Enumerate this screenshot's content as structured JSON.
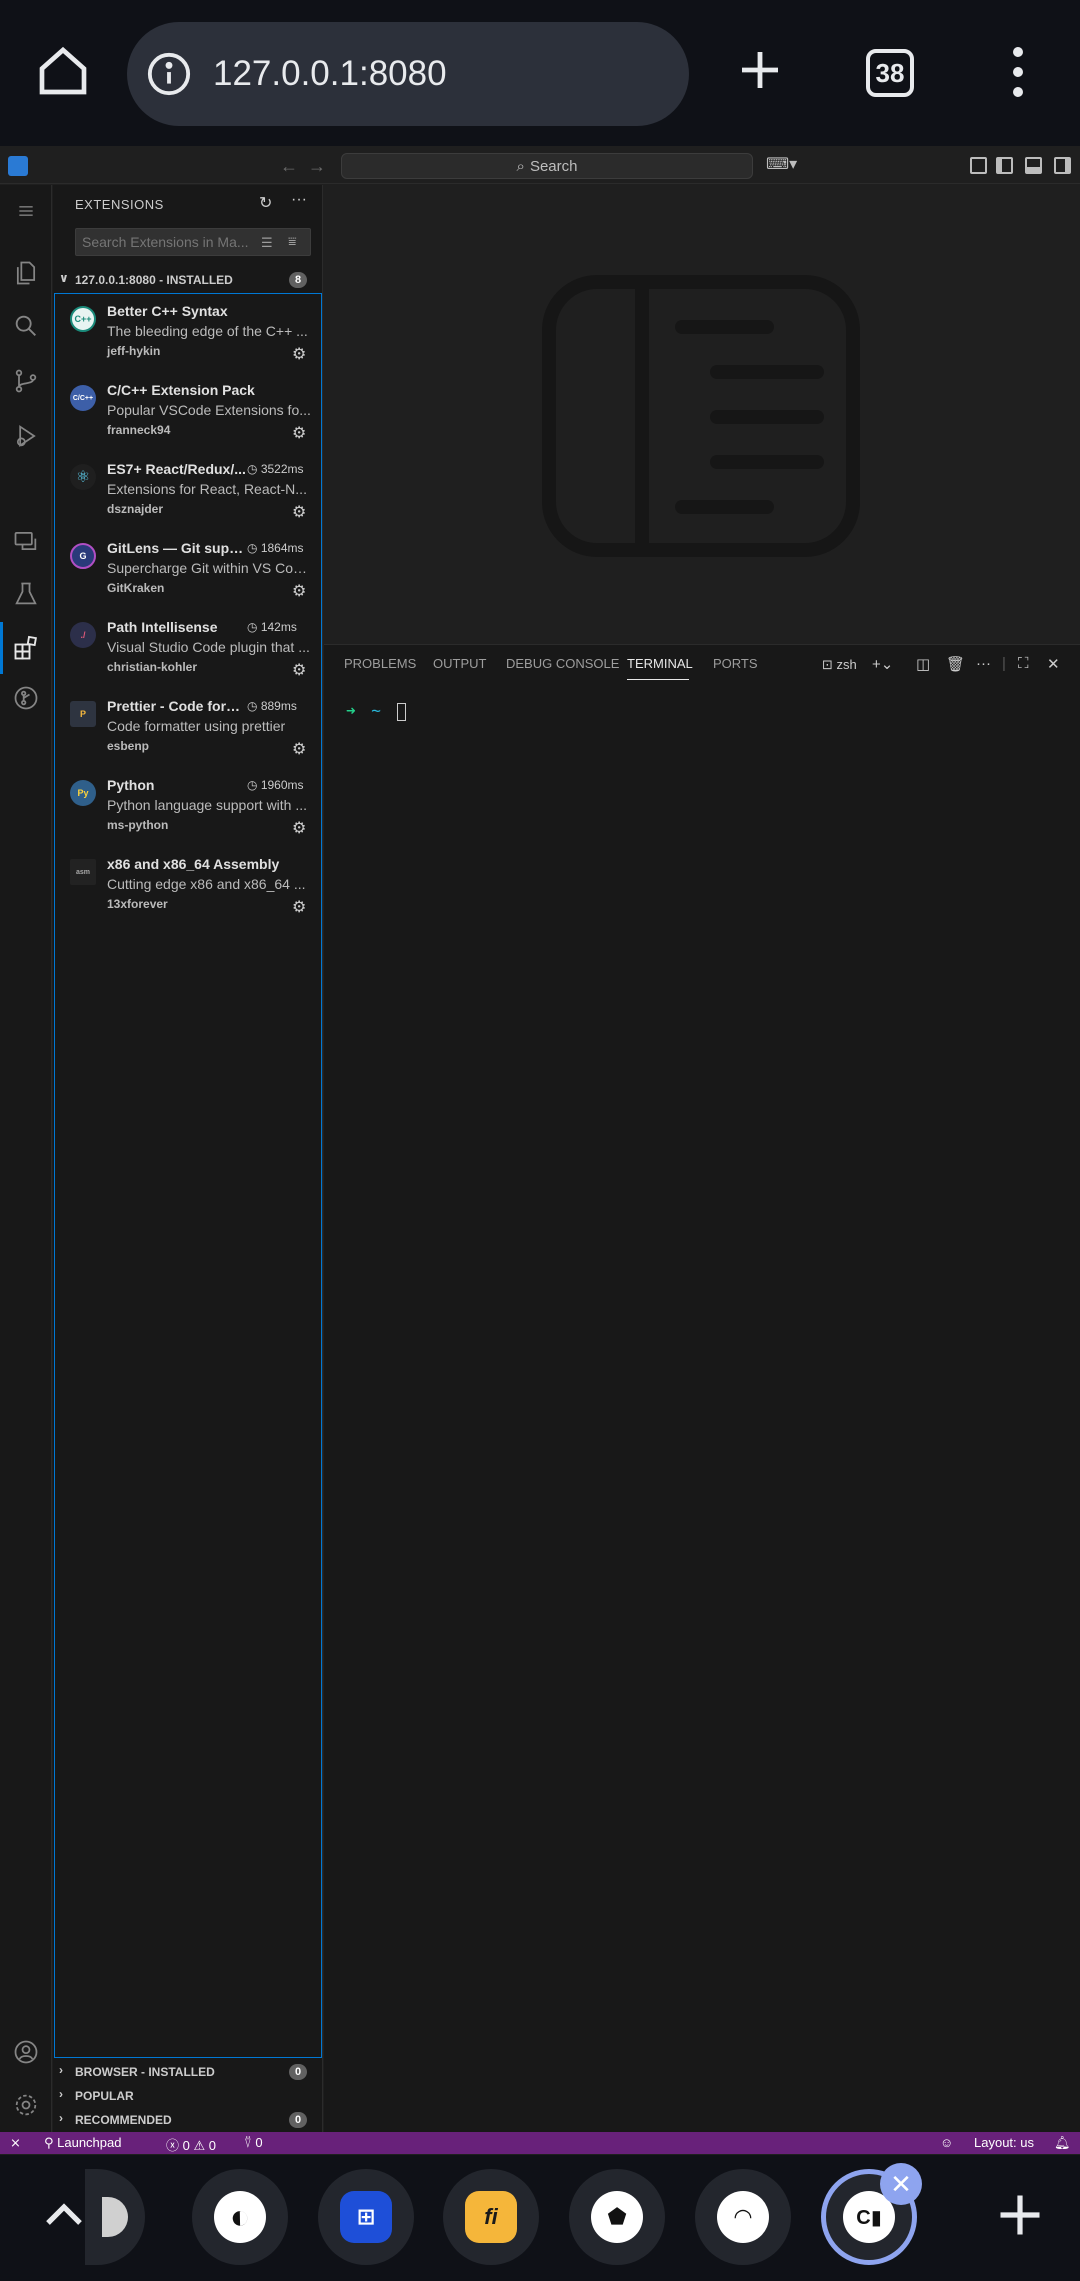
{
  "browser": {
    "url": "127.0.0.1:8080",
    "tab_count": "38"
  },
  "titlebar": {
    "search_label": "Search"
  },
  "sidebar": {
    "title": "EXTENSIONS",
    "search_placeholder": "Search Extensions in Ma...",
    "installed_section": {
      "label": "127.0.0.1:8080 - INSTALLED",
      "count": "8"
    },
    "extensions": [
      {
        "name": "Better C++ Syntax",
        "time": "",
        "description": "The bleeding edge of the C++ ...",
        "publisher": "jeff-hykin",
        "icon": "cpp-syntax-icon",
        "icon_color": "#e8f4f2",
        "icon_text": "C++"
      },
      {
        "name": "C/C++ Extension Pack",
        "time": "",
        "description": "Popular VSCode Extensions fo...",
        "publisher": "franneck94",
        "icon": "cpp-pack-icon",
        "icon_color": "#3d5fa8",
        "icon_text": "C/C++"
      },
      {
        "name": "ES7+ React/Redux/...",
        "time": "3522ms",
        "description": "Extensions for React, React-N...",
        "publisher": "dsznajder",
        "icon": "react-icon",
        "icon_color": "#1f1f1f",
        "icon_text": "⚛"
      },
      {
        "name": "GitLens — Git super...",
        "time": "1864ms",
        "description": "Supercharge Git within VS Cod...",
        "publisher": "GitKraken",
        "icon": "gitlens-icon",
        "icon_color": "#2a3a7a",
        "icon_text": "G"
      },
      {
        "name": "Path Intellisense",
        "time": "142ms",
        "description": "Visual Studio Code plugin that ...",
        "publisher": "christian-kohler",
        "icon": "path-icon",
        "icon_color": "#2c2f4a",
        "icon_text": "./"
      },
      {
        "name": "Prettier - Code form...",
        "time": "889ms",
        "description": "Code formatter using prettier",
        "publisher": "esbenp",
        "icon": "prettier-icon",
        "icon_color": "#2e3440",
        "icon_text": "P"
      },
      {
        "name": "Python",
        "time": "1960ms",
        "description": "Python language support with ...",
        "publisher": "ms-python",
        "icon": "python-icon",
        "icon_color": "#2f5f8a",
        "icon_text": "Py"
      },
      {
        "name": "x86 and x86_64 Assembly",
        "time": "",
        "description": "Cutting edge x86 and x86_64 ...",
        "publisher": "13xforever",
        "icon": "asm-icon",
        "icon_color": "#222222",
        "icon_text": "asm"
      }
    ],
    "browser_section": {
      "label": "BROWSER - INSTALLED",
      "count": "0"
    },
    "popular_section": {
      "label": "POPULAR"
    },
    "recommended_section": {
      "label": "RECOMMENDED",
      "count": "0"
    }
  },
  "panel": {
    "tabs": [
      "PROBLEMS",
      "OUTPUT",
      "DEBUG CONSOLE",
      "TERMINAL",
      "PORTS"
    ],
    "active_tab": "TERMINAL",
    "shell": "zsh",
    "prompt_arrow": "➜",
    "prompt_dir": "~"
  },
  "statusbar": {
    "launchpad": "Launchpad",
    "errors": "0",
    "warnings": "0",
    "ports": "0",
    "layout": "Layout: us"
  },
  "colors": {
    "accent": "#0078d4",
    "statusbar": "#68217a",
    "terminal_prompt": "#23d18b"
  }
}
